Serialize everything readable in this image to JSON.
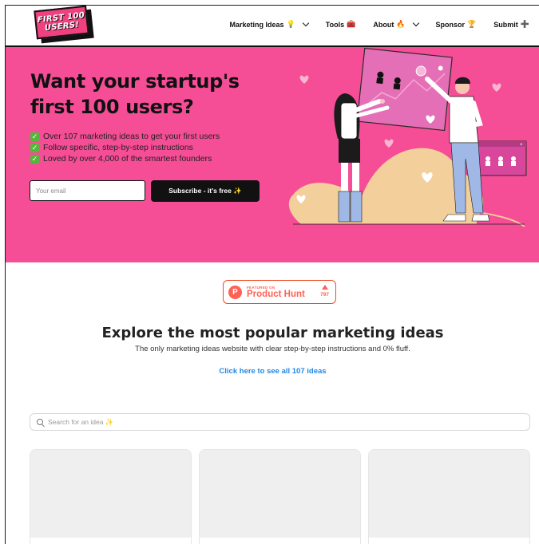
{
  "header": {
    "logo_line1": "FIRST 100",
    "logo_line2": "USERS!",
    "nav": [
      {
        "label": "Marketing Ideas",
        "emoji": "💡",
        "has_dropdown": true
      },
      {
        "label": "Tools",
        "emoji": "🧰",
        "has_dropdown": false
      },
      {
        "label": "About",
        "emoji": "🔥",
        "has_dropdown": true
      },
      {
        "label": "Sponsor",
        "emoji": "🏆",
        "has_dropdown": false
      },
      {
        "label": "Submit",
        "emoji": "➕",
        "has_dropdown": false
      }
    ]
  },
  "hero": {
    "title": "Want your startup's first 100 users?",
    "bullets": [
      "Over 107 marketing ideas to get your first users",
      "Follow specific, step-by-step instructions",
      "Loved by over 4,000 of the smartest founders"
    ],
    "email_placeholder": "Your email",
    "subscribe_label": "Subscribe - it's free ✨"
  },
  "product_hunt": {
    "featured": "FEATURED ON",
    "name": "Product Hunt",
    "votes": "797"
  },
  "explore": {
    "title": "Explore the most popular marketing ideas",
    "subtitle": "The only marketing ideas website with clear step-by-step instructions and 0% fluff.",
    "link": "Click here to see all 107 ideas"
  },
  "search": {
    "placeholder": "Search for an idea ✨"
  },
  "cards_count": 3,
  "colors": {
    "hero_pink": "#f54d96",
    "link_blue": "#1e88e5",
    "ph_orange": "#ff6154"
  }
}
